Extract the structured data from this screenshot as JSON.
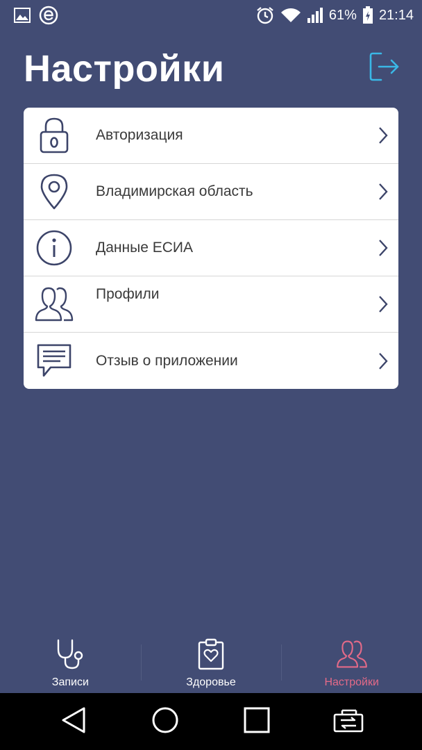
{
  "status_bar": {
    "battery": "61%",
    "time": "21:14"
  },
  "header": {
    "title": "Настройки"
  },
  "settings": {
    "items": [
      {
        "label": "Авторизация",
        "icon": "lock-icon"
      },
      {
        "label": "Владимирская область",
        "icon": "location-pin-icon"
      },
      {
        "label": "Данные ЕСИА",
        "icon": "info-icon"
      },
      {
        "label": "Профили",
        "sublabel": "",
        "icon": "users-icon"
      },
      {
        "label": "Отзыв о приложении",
        "icon": "chat-message-icon"
      }
    ]
  },
  "tabs": [
    {
      "label": "Записи",
      "icon": "stethoscope-icon",
      "active": false
    },
    {
      "label": "Здоровье",
      "icon": "clipboard-heart-icon",
      "active": false
    },
    {
      "label": "Настройки",
      "icon": "users-icon",
      "active": true
    }
  ],
  "colors": {
    "background": "#424c74",
    "card": "#ffffff",
    "icon_dark": "#3c4469",
    "accent_active": "#e46a88",
    "logout_accent": "#3ab7e6"
  }
}
